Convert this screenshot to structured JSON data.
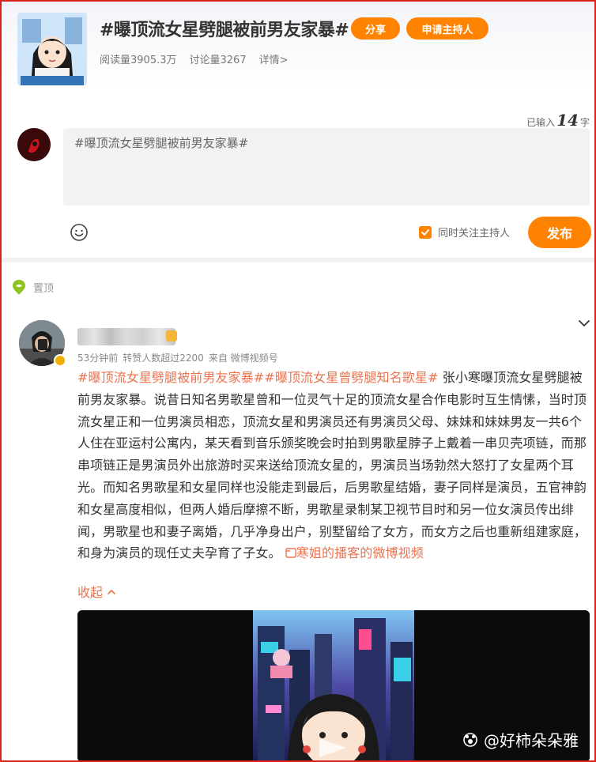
{
  "topic": {
    "title": "#曝顶流女星劈腿被前男友家暴#",
    "share_label": "分享",
    "apply_host_label": "申请主持人",
    "reads_label": "阅读量3905.3万",
    "comments_label": "讨论量3267",
    "details_label": "详情>"
  },
  "composer": {
    "typed_prefix": "已输入",
    "typed_count": "14",
    "typed_suffix": "字",
    "text": "#曝顶流女星劈腿被前男友家暴#",
    "follow_host_label": "同时关注主持人",
    "follow_host_checked": true,
    "post_label": "发布"
  },
  "pinned_label": "置顶",
  "post": {
    "meta_time": "53分钟前",
    "meta_reposts": "转赞人数超过2200",
    "meta_source": "来自 微博视频号",
    "tag1": "#曝顶流女星劈腿被前男友家暴#",
    "tag2": "#曝顶流女星曾劈腿知名歌星#",
    "body": " 张小寒曝顶流女星劈腿被前男友家暴。说昔日知名男歌星曾和一位灵气十足的顶流女星合作电影时互生情愫，当时顶流女星正和一位男演员相恋，顶流女星和男演员还有男演员父母、妹妹和妹妹男友一共6个人住在亚运村公寓内，某天看到音乐颁奖晚会时拍到男歌星脖子上戴着一串贝壳项链，而那串项链正是男演员外出旅游时买来送给顶流女星的，男演员当场勃然大怒打了女星两个耳光。而知名男歌星和女星同样也没能走到最后，后男歌星结婚，妻子同样是演员，五官神韵和女星高度相似，但两人婚后摩擦不断，男歌星录制某卫视节目时和另一位女演员传出绯闻，男歌星也和妻子离婚，几乎净身出户，别墅留给了女方，而女方之后也重新组建家庭，和身为演员的现任丈夫孕育了子女。",
    "video_link": "寒姐的播客的微博视频",
    "collapse_label": "收起"
  },
  "video": {
    "watermark": "@好柿朵朵雅"
  },
  "colors": {
    "accent": "#ff8200",
    "link": "#eb7350",
    "frame": "#d9231c"
  }
}
